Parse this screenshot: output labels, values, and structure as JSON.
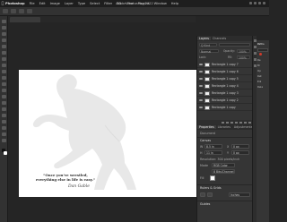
{
  "menubar": {
    "items": [
      "Photoshop",
      "File",
      "Edit",
      "Image",
      "Layer",
      "Type",
      "Select",
      "Filter",
      "3D",
      "View",
      "Plugins",
      "Window",
      "Help"
    ],
    "window_title": "Adobe Photoshop 2022"
  },
  "document_tab": {
    "label": ""
  },
  "canvas": {
    "quote_line1": "“Once you’ve wrestled,",
    "quote_line2": "everything else in life is easy.”",
    "signature": "Dan Gable"
  },
  "layers_panel": {
    "tabs": [
      "Layers",
      "Channels"
    ],
    "kind_label": "Q Kind",
    "blend_mode": "Normal",
    "opacity_label": "Opacity:",
    "opacity_value": "100%",
    "lock_label": "Lock:",
    "fill_label": "Fill:",
    "fill_value": "100%",
    "layers": [
      "Rectangle 1 copy 7",
      "Rectangle 1 copy 6",
      "Rectangle 1 copy 5",
      "Rectangle 1 copy 4",
      "Rectangle 1 copy 3",
      "Rectangle 1 copy 2",
      "Rectangle 1 copy"
    ]
  },
  "properties_panel": {
    "tabs": [
      "Properties",
      "Libraries",
      "Adjustments"
    ],
    "doc_label": "Document",
    "canvas_heading": "Canvas",
    "width_label": "W",
    "width_value": "8.5 in",
    "height_label": "H",
    "height_value": "11 in",
    "x_label": "X",
    "y_label": "Y",
    "x_value": "0 px",
    "y_value": "0 px",
    "resolution": "Resolution: 300 pixels/inch",
    "mode_label": "Mode",
    "mode_value": "RGB Color",
    "bit_value": "8 Bits/Channel",
    "fill_label": "Fill",
    "rulers_heading": "Rulers & Grids",
    "unit_value": "Inches",
    "guides_heading": "Guides"
  },
  "far_props": {
    "items": [
      "Paths",
      "Re",
      "Br",
      "Op",
      "Ret",
      "Edi",
      "Rela"
    ]
  },
  "colors": {
    "canvas": "#ffffff",
    "silhouette": "#e8e8e8",
    "panel_bg": "#353535",
    "selected_layer": "#4a4a4a"
  }
}
